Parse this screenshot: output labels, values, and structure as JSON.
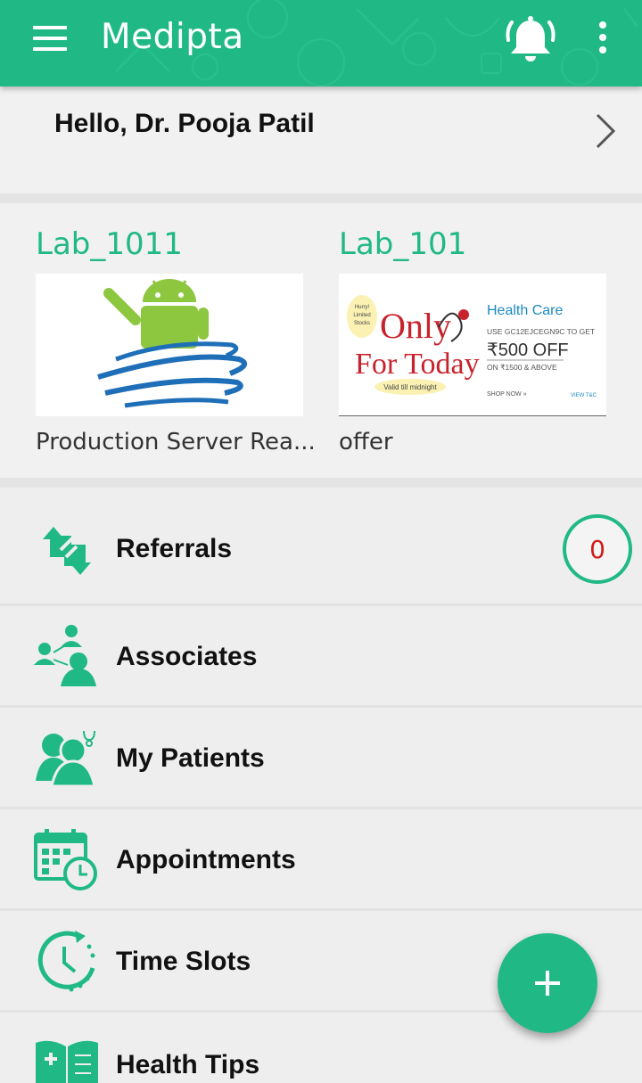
{
  "app": {
    "title": "Medipta",
    "colors": {
      "primary": "#20b986",
      "badge_text": "#d11b1b"
    },
    "icons": {
      "menu": "hamburger-icon",
      "notifications": "bell-icon",
      "more": "more-vert-icon"
    }
  },
  "greeting": {
    "text": "Hello, Dr. Pooja Patil",
    "icon": "chevron-right-icon"
  },
  "labs": [
    {
      "name": "Lab_1011",
      "caption": "Production Server Rea..."
    },
    {
      "name": "Lab_101",
      "caption": "offer"
    }
  ],
  "promo": {
    "hurry": [
      "Hurry!",
      "Limited",
      "Stocks"
    ],
    "headline1": "Only",
    "headline2": "For Today",
    "valid": "Valid till midnight",
    "brand": "Health Care",
    "code_line": "USE GC12EJCEGN9C TO GET",
    "amount": "₹500 OFF",
    "condition": "ON ₹1500 & ABOVE",
    "shop": "SHOP NOW »",
    "terms": "VIEW T&C"
  },
  "menu": [
    {
      "label": "Referrals",
      "icon": "referrals-icon",
      "badge": "0"
    },
    {
      "label": "Associates",
      "icon": "associates-icon"
    },
    {
      "label": "My Patients",
      "icon": "patients-icon"
    },
    {
      "label": "Appointments",
      "icon": "calendar-clock-icon"
    },
    {
      "label": "Time Slots",
      "icon": "clock-icon"
    },
    {
      "label": "Health Tips",
      "icon": "health-book-icon"
    }
  ],
  "fab": {
    "icon": "plus-icon"
  }
}
